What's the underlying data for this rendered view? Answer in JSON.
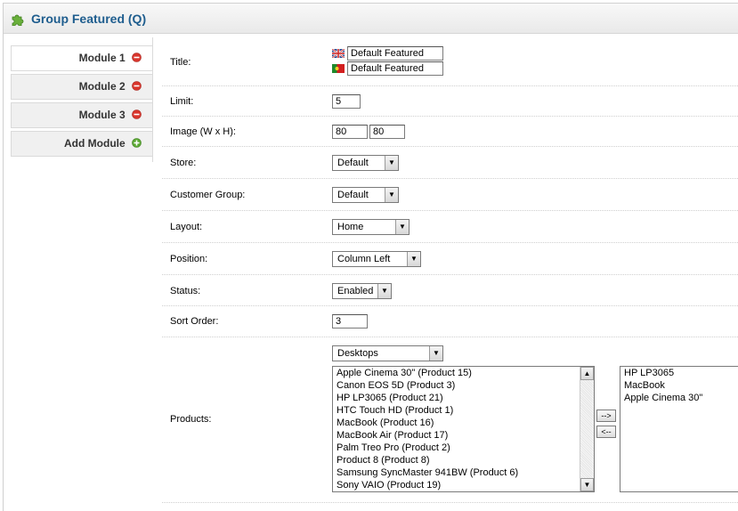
{
  "heading": {
    "title": "Group Featured (Q)",
    "icon": "puzzle-piece-icon"
  },
  "tabs": [
    {
      "label": "Module 1",
      "icon": "remove-icon"
    },
    {
      "label": "Module 2",
      "icon": "remove-icon"
    },
    {
      "label": "Module 3",
      "icon": "remove-icon"
    },
    {
      "label": "Add Module",
      "icon": "add-icon"
    }
  ],
  "form": {
    "title": {
      "label": "Title:",
      "en_value": "Default Featured",
      "pt_value": "Default Featured"
    },
    "limit": {
      "label": "Limit:",
      "value": "5"
    },
    "image": {
      "label": "Image (W x H):",
      "width": "80",
      "height": "80"
    },
    "store": {
      "label": "Store:",
      "value": "Default"
    },
    "customer_group": {
      "label": "Customer Group:",
      "value": "Default"
    },
    "layout": {
      "label": "Layout:",
      "value": "Home"
    },
    "position": {
      "label": "Position:",
      "value": "Column Left"
    },
    "status": {
      "label": "Status:",
      "value": "Enabled"
    },
    "sort_order": {
      "label": "Sort Order:",
      "value": "3"
    },
    "products": {
      "label": "Products:",
      "category": "Desktops",
      "available": [
        "Apple Cinema 30\" (Product 15)",
        "Canon EOS 5D (Product 3)",
        "HP LP3065 (Product 21)",
        "HTC Touch HD (Product 1)",
        "MacBook (Product 16)",
        "MacBook Air (Product 17)",
        "Palm Treo Pro (Product 2)",
        "Product 8 (Product 8)",
        "Samsung SyncMaster 941BW (Product 6)",
        "Sony VAIO (Product 19)"
      ],
      "add_button": "-->",
      "remove_button": "<--",
      "selected": [
        "HP LP3065",
        "MacBook",
        "Apple Cinema 30\""
      ]
    }
  },
  "colors": {
    "title": "#1e5d8e",
    "remove": "#d9352c",
    "add": "#5aa832"
  }
}
